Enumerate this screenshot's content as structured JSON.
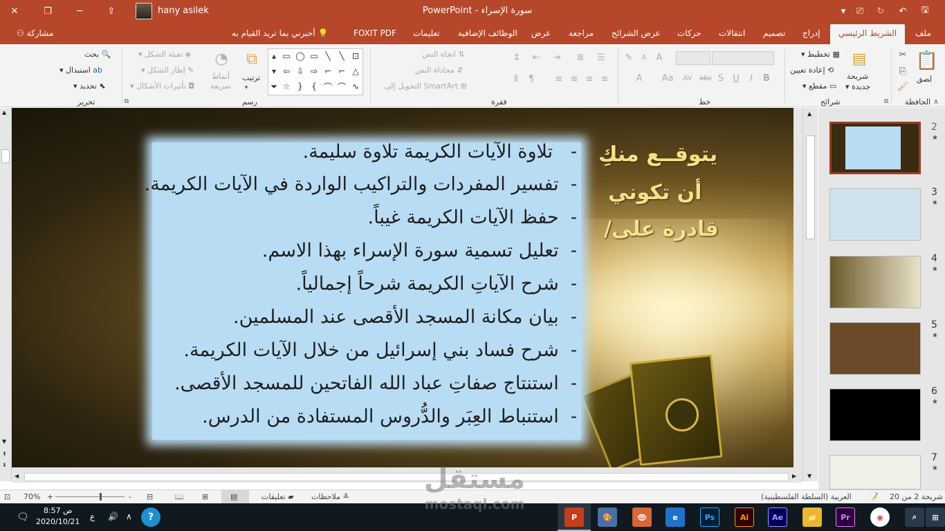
{
  "app": {
    "title_doc": "سورة الإسراء",
    "title_sep": "-",
    "title_app": "PowerPoint",
    "user_name": "hany asilek"
  },
  "tabs": [
    {
      "label": "ملف"
    },
    {
      "label": "الشريط الرئيسي"
    },
    {
      "label": "إدراج"
    },
    {
      "label": "تصميم"
    },
    {
      "label": "انتقالات"
    },
    {
      "label": "حركات"
    },
    {
      "label": "عرض الشرائح"
    },
    {
      "label": "مراجعة"
    },
    {
      "label": "عرض"
    },
    {
      "label": "الوظائف الإضافية"
    },
    {
      "label": "تعليمات"
    },
    {
      "label": "FOXIT PDF"
    },
    {
      "label": "أخبرني بما تريد القيام به"
    },
    {
      "label": "مشاركة"
    }
  ],
  "ribbon": {
    "clipboard": {
      "label": "الحافظة",
      "paste": "لصق"
    },
    "slides": {
      "label": "شرائح",
      "new_slide_1": "شريحة",
      "new_slide_2": "جديدة",
      "layout": "تخطيط",
      "reset": "إعادة تعيين",
      "section": "مقطع"
    },
    "font": {
      "label": "خط"
    },
    "paragraph": {
      "label": "فقرة",
      "text_direction": "اتجاه النص",
      "align_text": "محاذاة النص",
      "smartart": "التحويل إلى SmartArt"
    },
    "drawing": {
      "label": "رسم",
      "arrange": "ترتيب",
      "quick_styles_1": "أنماط",
      "quick_styles_2": "سريعة",
      "shape_fill": "تعبئة الشكل",
      "shape_outline": "إطار الشكل",
      "shape_effects": "تأثيرات الأشكال"
    },
    "editing": {
      "label": "تحرير",
      "find": "بحث",
      "replace": "استبدال",
      "select": "تحديد"
    }
  },
  "slide": {
    "heading": [
      "يتوقــع منكِ",
      "أن تكوني",
      "قادرة على/"
    ],
    "bullets": [
      "تلاوة الآيات الكريمة تلاوة سليمة.",
      "تفسير المفردات والتراكيب الواردة في الآيات الكريمة.",
      "حفظ الآيات الكريمة غيباً.",
      "تعليل تسمية سورة الإسراء بهذا الاسم.",
      "شرح الآياتِ الكريمة شرحاً إجمالياً.",
      "بيان مكانة المسجد الأقصى عند المسلمين.",
      "شرح فساد بني إسرائيل من خلال الآيات الكريمة.",
      "استنتاج صفاتِ عباد الله الفاتحين للمسجد الأقصى.",
      "استنباط العِبَر والدُّروس المستفادة من الدرس."
    ],
    "bullet_marker": "-"
  },
  "thumbnails": [
    {
      "num": "2",
      "star": "★",
      "bg": "#b9dcf5"
    },
    {
      "num": "3",
      "star": "★",
      "bg": "#cfe3ee"
    },
    {
      "num": "4",
      "star": "★",
      "bg": "#e9e2c8"
    },
    {
      "num": "5",
      "star": "★",
      "bg": "#6b4a2a"
    },
    {
      "num": "6",
      "star": "★",
      "bg": "#000000"
    },
    {
      "num": "7",
      "star": "★",
      "bg": "#f0efe8"
    }
  ],
  "status": {
    "slide_pos": "شريحة 2 من 20",
    "language": "العربية (السلطة الفلسطينية)",
    "notes": "ملاحظات",
    "comments": "تعليقات",
    "zoom": "70%",
    "zoom_minus": "-",
    "zoom_plus": "+"
  },
  "taskbar": {
    "time": "8:57 ص",
    "date": "2020/10/21",
    "lang": "ع"
  },
  "watermark": {
    "line1": "مستقل",
    "line2": "mostaql.com"
  },
  "colors": {
    "accent": "#b7472a",
    "textbox": "#b9dcf5",
    "heading": "#f6e08a"
  }
}
